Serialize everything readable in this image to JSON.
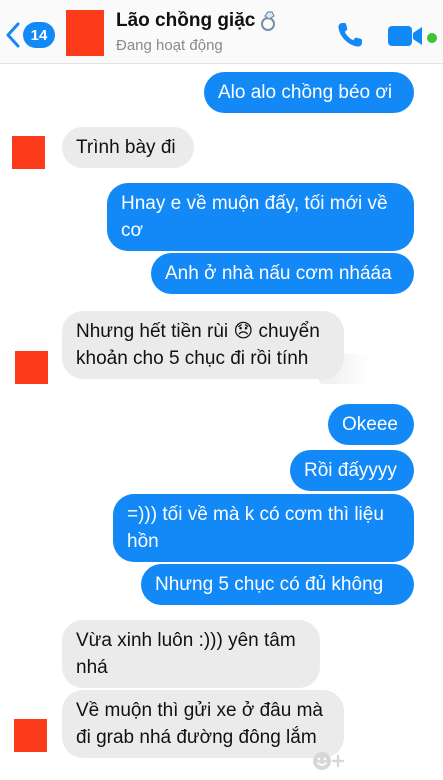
{
  "header": {
    "unread_count": "14",
    "contact_name": "Lão chồng giặc",
    "status": "Đang hoạt động",
    "icons": {
      "back": "chevron-left-icon",
      "call": "phone-icon",
      "video": "video-camera-icon",
      "title_emoji": "ring-icon"
    },
    "colors": {
      "accent": "#1289f7",
      "online": "#3cc431",
      "avatar_redaction": "#fb3b1a"
    }
  },
  "messages": [
    {
      "sender": "me",
      "text": "Alo alo chồng béo ơi"
    },
    {
      "sender": "them",
      "text": "Trình bày đi"
    },
    {
      "sender": "me",
      "text": "Hnay e về muộn đấy, tối mới về\ncơ"
    },
    {
      "sender": "me",
      "text": "Anh ở nhà nấu cơm nhááa"
    },
    {
      "sender": "them",
      "text": "Nhưng hết tiền rùi 😞 chuyển\nkhoản cho 5 chục đi rồi tính"
    },
    {
      "sender": "me",
      "text": "Okeee"
    },
    {
      "sender": "me",
      "text": "Rồi đấyyyy"
    },
    {
      "sender": "me",
      "text": "=))) tối về mà k có cơm thì liệu\nhồn"
    },
    {
      "sender": "me",
      "text": "Nhưng 5 chục có đủ không"
    },
    {
      "sender": "them",
      "text": "Vừa xinh luôn :))) yên tâm\nnhá"
    },
    {
      "sender": "them",
      "text": "Về muộn thì gửi xe ở đâu mà\nđi grab nhá đường đông lắm"
    }
  ],
  "reaction_button_icon": "add-reaction-icon"
}
